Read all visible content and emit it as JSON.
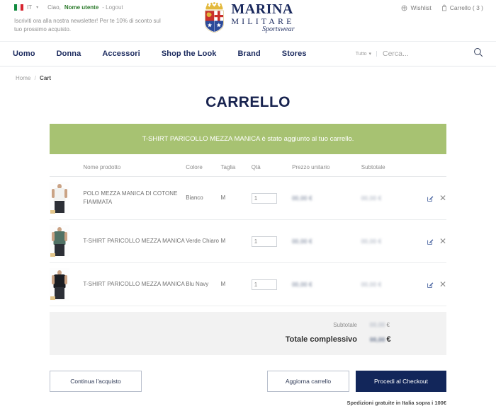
{
  "topbar": {
    "flag_icon": "italy-flag-icon",
    "lang_code": "IT",
    "greeting": "Ciao,",
    "username": "Nome utente",
    "logout": "- Logout",
    "newsletter": "Iscriviti ora alla nostra newsletter! Per te 10% di sconto sul tuo prossimo acquisto.",
    "wishlist": "Wishlist",
    "cart": "Carrello ( 3 )"
  },
  "logo": {
    "line1": "MARINA",
    "line2": "MILITARE",
    "line3": "Sportswear"
  },
  "nav": {
    "links": [
      {
        "label": "Uomo"
      },
      {
        "label": "Donna"
      },
      {
        "label": "Accessori"
      },
      {
        "label": "Shop the Look"
      },
      {
        "label": "Brand"
      },
      {
        "label": "Stores"
      }
    ],
    "search_scope": "Tutto",
    "search_placeholder": "Cerca..."
  },
  "breadcrumb": {
    "home": "Home",
    "sep": "/",
    "current": "Cart"
  },
  "main": {
    "title": "CARRELLO",
    "alert": "T-SHIRT PARICOLLO MEZZA MANICA è stato aggiunto al tuo carrello."
  },
  "table": {
    "headers": {
      "image": "",
      "name": "Nome prodotto",
      "color": "Colore",
      "size": "Taglia",
      "qty": "Qtà",
      "price": "Prezzo unitario",
      "subtotal": "Subtotale",
      "actions": ""
    },
    "rows": [
      {
        "name": "POLO MEZZA MANICA DI COTONE FIAMMATA",
        "color": "Bianco",
        "size": "M",
        "qty": "1",
        "price": "00,00 €",
        "subtotal": "00,00 €",
        "shirt_color": "#f2f2f0",
        "edit_icon": "edit-icon",
        "remove_icon": "remove-icon"
      },
      {
        "name": "T-SHIRT PARICOLLO MEZZA MANICA",
        "color": "Verde Chiaro",
        "size": "M",
        "qty": "1",
        "price": "00,00 €",
        "subtotal": "00,00 €",
        "shirt_color": "#517265",
        "edit_icon": "edit-icon",
        "remove_icon": "remove-icon"
      },
      {
        "name": "T-SHIRT PARICOLLO MEZZA MANICA",
        "color": "Blu Navy",
        "size": "M",
        "qty": "1",
        "price": "00,00 €",
        "subtotal": "00,00 €",
        "shirt_color": "#1b1d22",
        "edit_icon": "edit-icon",
        "remove_icon": "remove-icon"
      }
    ]
  },
  "totals": {
    "subtotal_label": "Subtotale",
    "subtotal_value": "00,00",
    "total_label": "Totale complessivo",
    "total_value": "00,00",
    "currency": "€"
  },
  "actions": {
    "continue": "Continua l'acquisto",
    "update": "Aggiorna carrello",
    "checkout": "Procedi al Checkout",
    "shipping_note": "Spedizioni gratuite in Italia sopra i 100€"
  }
}
